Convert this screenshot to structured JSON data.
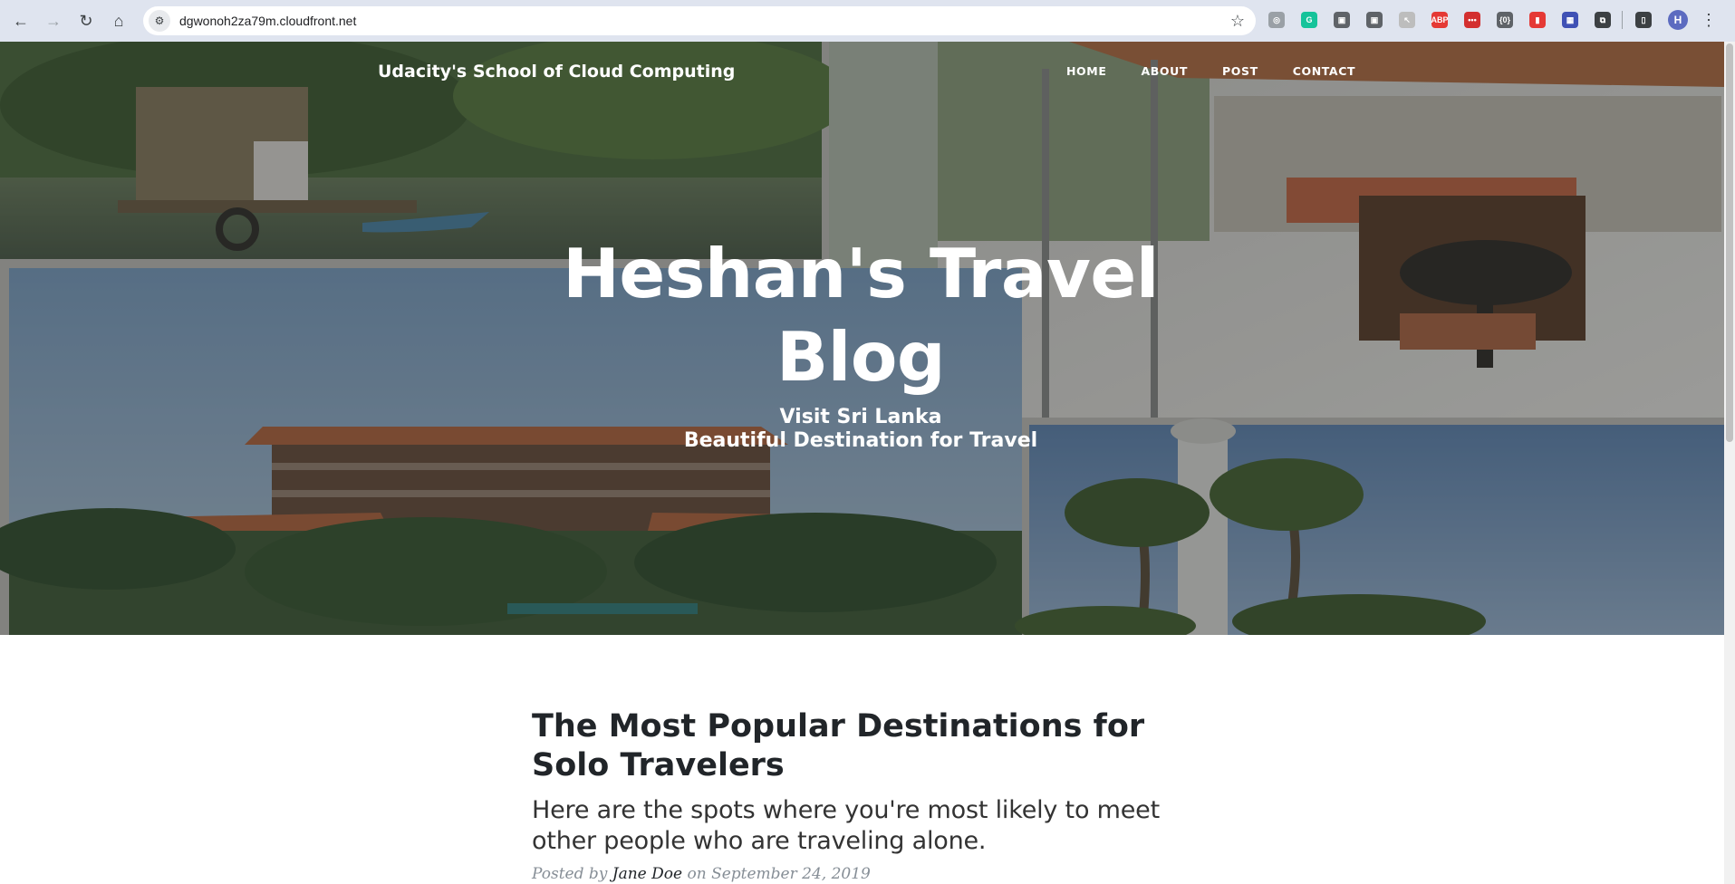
{
  "browser": {
    "url": "dgwonoh2za79m.cloudfront.net",
    "profile_initial": "H",
    "extensions": [
      {
        "name": "extension-icon",
        "glyph": "◎",
        "color": "#9aa0a6"
      },
      {
        "name": "grammarly-extension-icon",
        "glyph": "G",
        "color": "#15c39a"
      },
      {
        "name": "extension-icon",
        "glyph": "▣",
        "color": "#5f6368"
      },
      {
        "name": "extension-icon",
        "glyph": "▣",
        "color": "#5f6368"
      },
      {
        "name": "extension-icon",
        "glyph": "↖",
        "color": "#bdbdbd"
      },
      {
        "name": "adblock-extension-icon",
        "glyph": "ABP",
        "color": "#e53935"
      },
      {
        "name": "extension-icon",
        "glyph": "•••",
        "color": "#d32f2f"
      },
      {
        "name": "extension-icon",
        "glyph": "{0}",
        "color": "#5f6368"
      },
      {
        "name": "extension-icon",
        "glyph": "▮",
        "color": "#e53935"
      },
      {
        "name": "extension-icon",
        "glyph": "▦",
        "color": "#3f51b5"
      },
      {
        "name": "extensions-puzzle-icon",
        "glyph": "⧉",
        "color": "#3c4043"
      }
    ]
  },
  "nav": {
    "brand": "Udacity's School of Cloud Computing",
    "links": [
      "HOME",
      "ABOUT",
      "POST",
      "CONTACT"
    ]
  },
  "hero": {
    "title": "Heshan's Travel Blog",
    "subtitle_line1": "Visit Sri Lanka",
    "subtitle_line2": "Beautiful Destination for Travel"
  },
  "post": {
    "title": "The Most Popular Destinations for Solo Travelers",
    "subtitle": "Here are the spots where you're most likely to meet other people who are traveling alone.",
    "meta_prefix": "Posted by",
    "author": "Jane Doe",
    "meta_on": "on",
    "date": "September 24, 2019"
  },
  "colors": {
    "chrome_bg": "#dfe4ef",
    "overlay": "rgba(33,37,41,0.42)",
    "heading": "#212529",
    "meta": "#868e96"
  }
}
